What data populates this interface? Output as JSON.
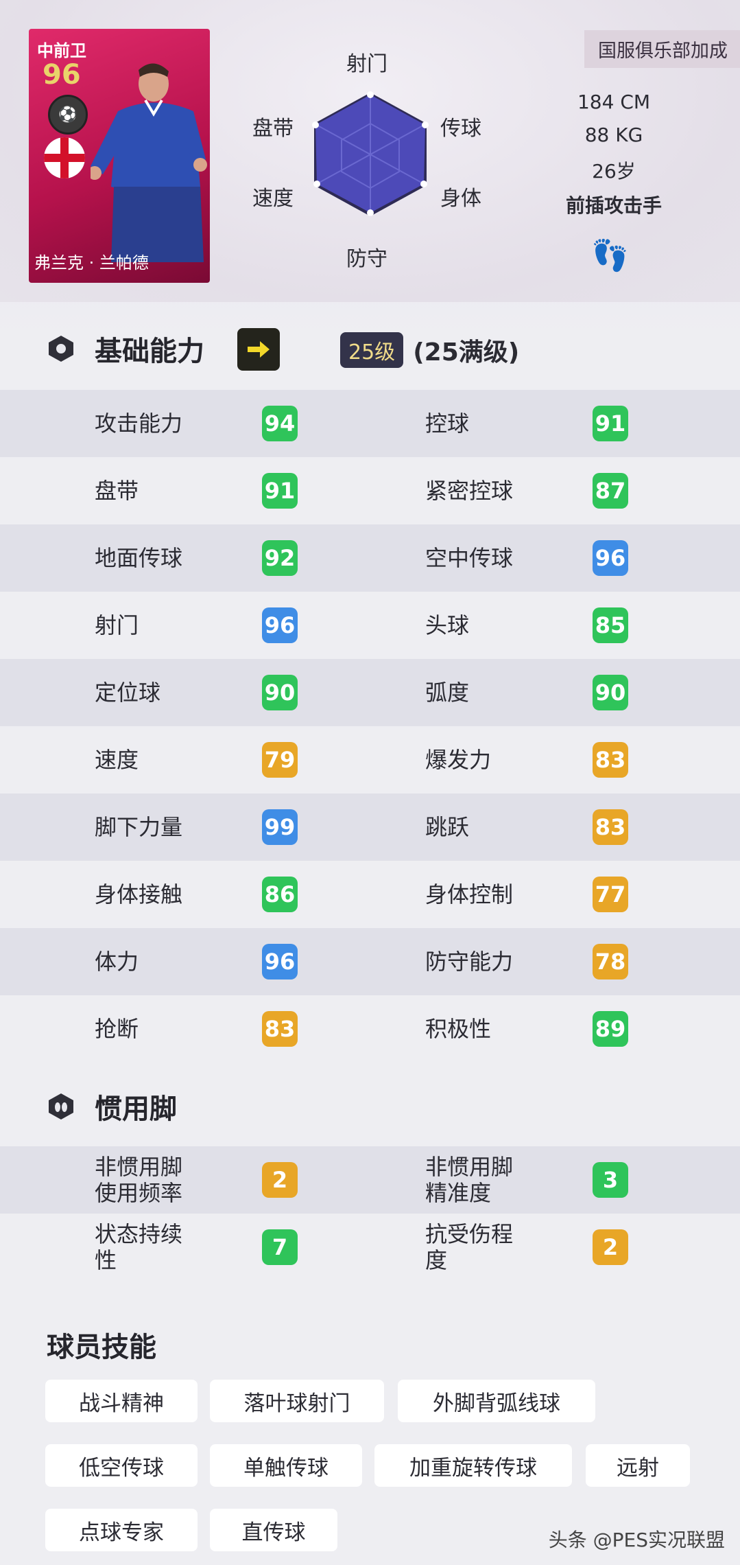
{
  "card": {
    "position": "中前卫",
    "rating": "96",
    "player_name": "弗兰克 · 兰帕德",
    "card_color": "#c8195a"
  },
  "radar": {
    "labels": {
      "shooting": "射门",
      "passing": "传球",
      "physical": "身体",
      "defense": "防守",
      "speed": "速度",
      "dribbling": "盘带"
    }
  },
  "profile": {
    "club_boost": "国服俱乐部加成",
    "height": "184 CM",
    "weight": "88 KG",
    "age": "26岁",
    "playstyle": "前插攻击手"
  },
  "basic": {
    "title": "基础能力",
    "level": "25级",
    "max_level": "(25满级)",
    "rows": [
      {
        "left": {
          "name": "攻击能力",
          "value": "94",
          "color": "green"
        },
        "right": {
          "name": "控球",
          "value": "91",
          "color": "green"
        }
      },
      {
        "left": {
          "name": "盘带",
          "value": "91",
          "color": "green"
        },
        "right": {
          "name": "紧密控球",
          "value": "87",
          "color": "green"
        }
      },
      {
        "left": {
          "name": "地面传球",
          "value": "92",
          "color": "green"
        },
        "right": {
          "name": "空中传球",
          "value": "96",
          "color": "blue"
        }
      },
      {
        "left": {
          "name": "射门",
          "value": "96",
          "color": "blue"
        },
        "right": {
          "name": "头球",
          "value": "85",
          "color": "green"
        }
      },
      {
        "left": {
          "name": "定位球",
          "value": "90",
          "color": "green"
        },
        "right": {
          "name": "弧度",
          "value": "90",
          "color": "green"
        }
      },
      {
        "left": {
          "name": "速度",
          "value": "79",
          "color": "orange"
        },
        "right": {
          "name": "爆发力",
          "value": "83",
          "color": "orange"
        }
      },
      {
        "left": {
          "name": "脚下力量",
          "value": "99",
          "color": "blue"
        },
        "right": {
          "name": "跳跃",
          "value": "83",
          "color": "orange"
        }
      },
      {
        "left": {
          "name": "身体接触",
          "value": "86",
          "color": "green"
        },
        "right": {
          "name": "身体控制",
          "value": "77",
          "color": "orange"
        }
      },
      {
        "left": {
          "name": "体力",
          "value": "96",
          "color": "blue"
        },
        "right": {
          "name": "防守能力",
          "value": "78",
          "color": "orange"
        }
      },
      {
        "left": {
          "name": "抢断",
          "value": "83",
          "color": "orange"
        },
        "right": {
          "name": "积极性",
          "value": "89",
          "color": "green"
        }
      }
    ]
  },
  "foot": {
    "title": "惯用脚",
    "rows": [
      {
        "left": {
          "line1": "非惯用脚",
          "line2": "使用频率",
          "value": "2",
          "color": "orange"
        },
        "right": {
          "line1": "非惯用脚",
          "line2": "精准度",
          "value": "3",
          "color": "green"
        }
      },
      {
        "left": {
          "line1": "状态持续",
          "line2": "性",
          "value": "7",
          "color": "green"
        },
        "right": {
          "line1": "抗受伤程",
          "line2": "度",
          "value": "2",
          "color": "orange"
        }
      }
    ]
  },
  "skills": {
    "title": "球员技能",
    "items": [
      "战斗精神",
      "落叶球射门",
      "外脚背弧线球",
      "低空传球",
      "单触传球",
      "加重旋转传球",
      "远射",
      "点球专家",
      "直传球"
    ]
  },
  "watermark": "头条 @PES实况联盟",
  "colors": {
    "green": "#2fc45a",
    "blue": "#3f8de6",
    "orange": "#e8a627"
  }
}
